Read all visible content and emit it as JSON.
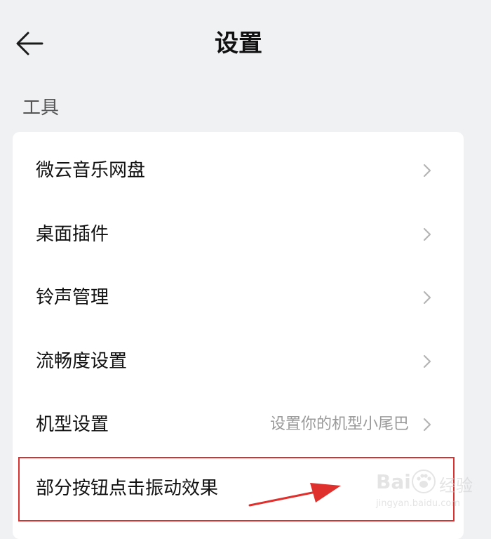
{
  "header": {
    "title": "设置",
    "back_icon": "arrow-left-icon"
  },
  "section": {
    "label": "工具"
  },
  "rows": [
    {
      "label": "微云音乐网盘",
      "value": ""
    },
    {
      "label": "桌面插件",
      "value": ""
    },
    {
      "label": "铃声管理",
      "value": ""
    },
    {
      "label": "流畅度设置",
      "value": ""
    },
    {
      "label": "机型设置",
      "value": "设置你的机型小尾巴"
    },
    {
      "label": "部分按钮点击振动效果",
      "value": ""
    }
  ],
  "watermark": {
    "brand": "Bai",
    "brand_cn": "经验",
    "site": "jingyan.baidu.com"
  },
  "colors": {
    "background": "#eff1f3",
    "card": "#ffffff",
    "highlight": "#d8312f",
    "chevron": "#b5b5b5"
  }
}
